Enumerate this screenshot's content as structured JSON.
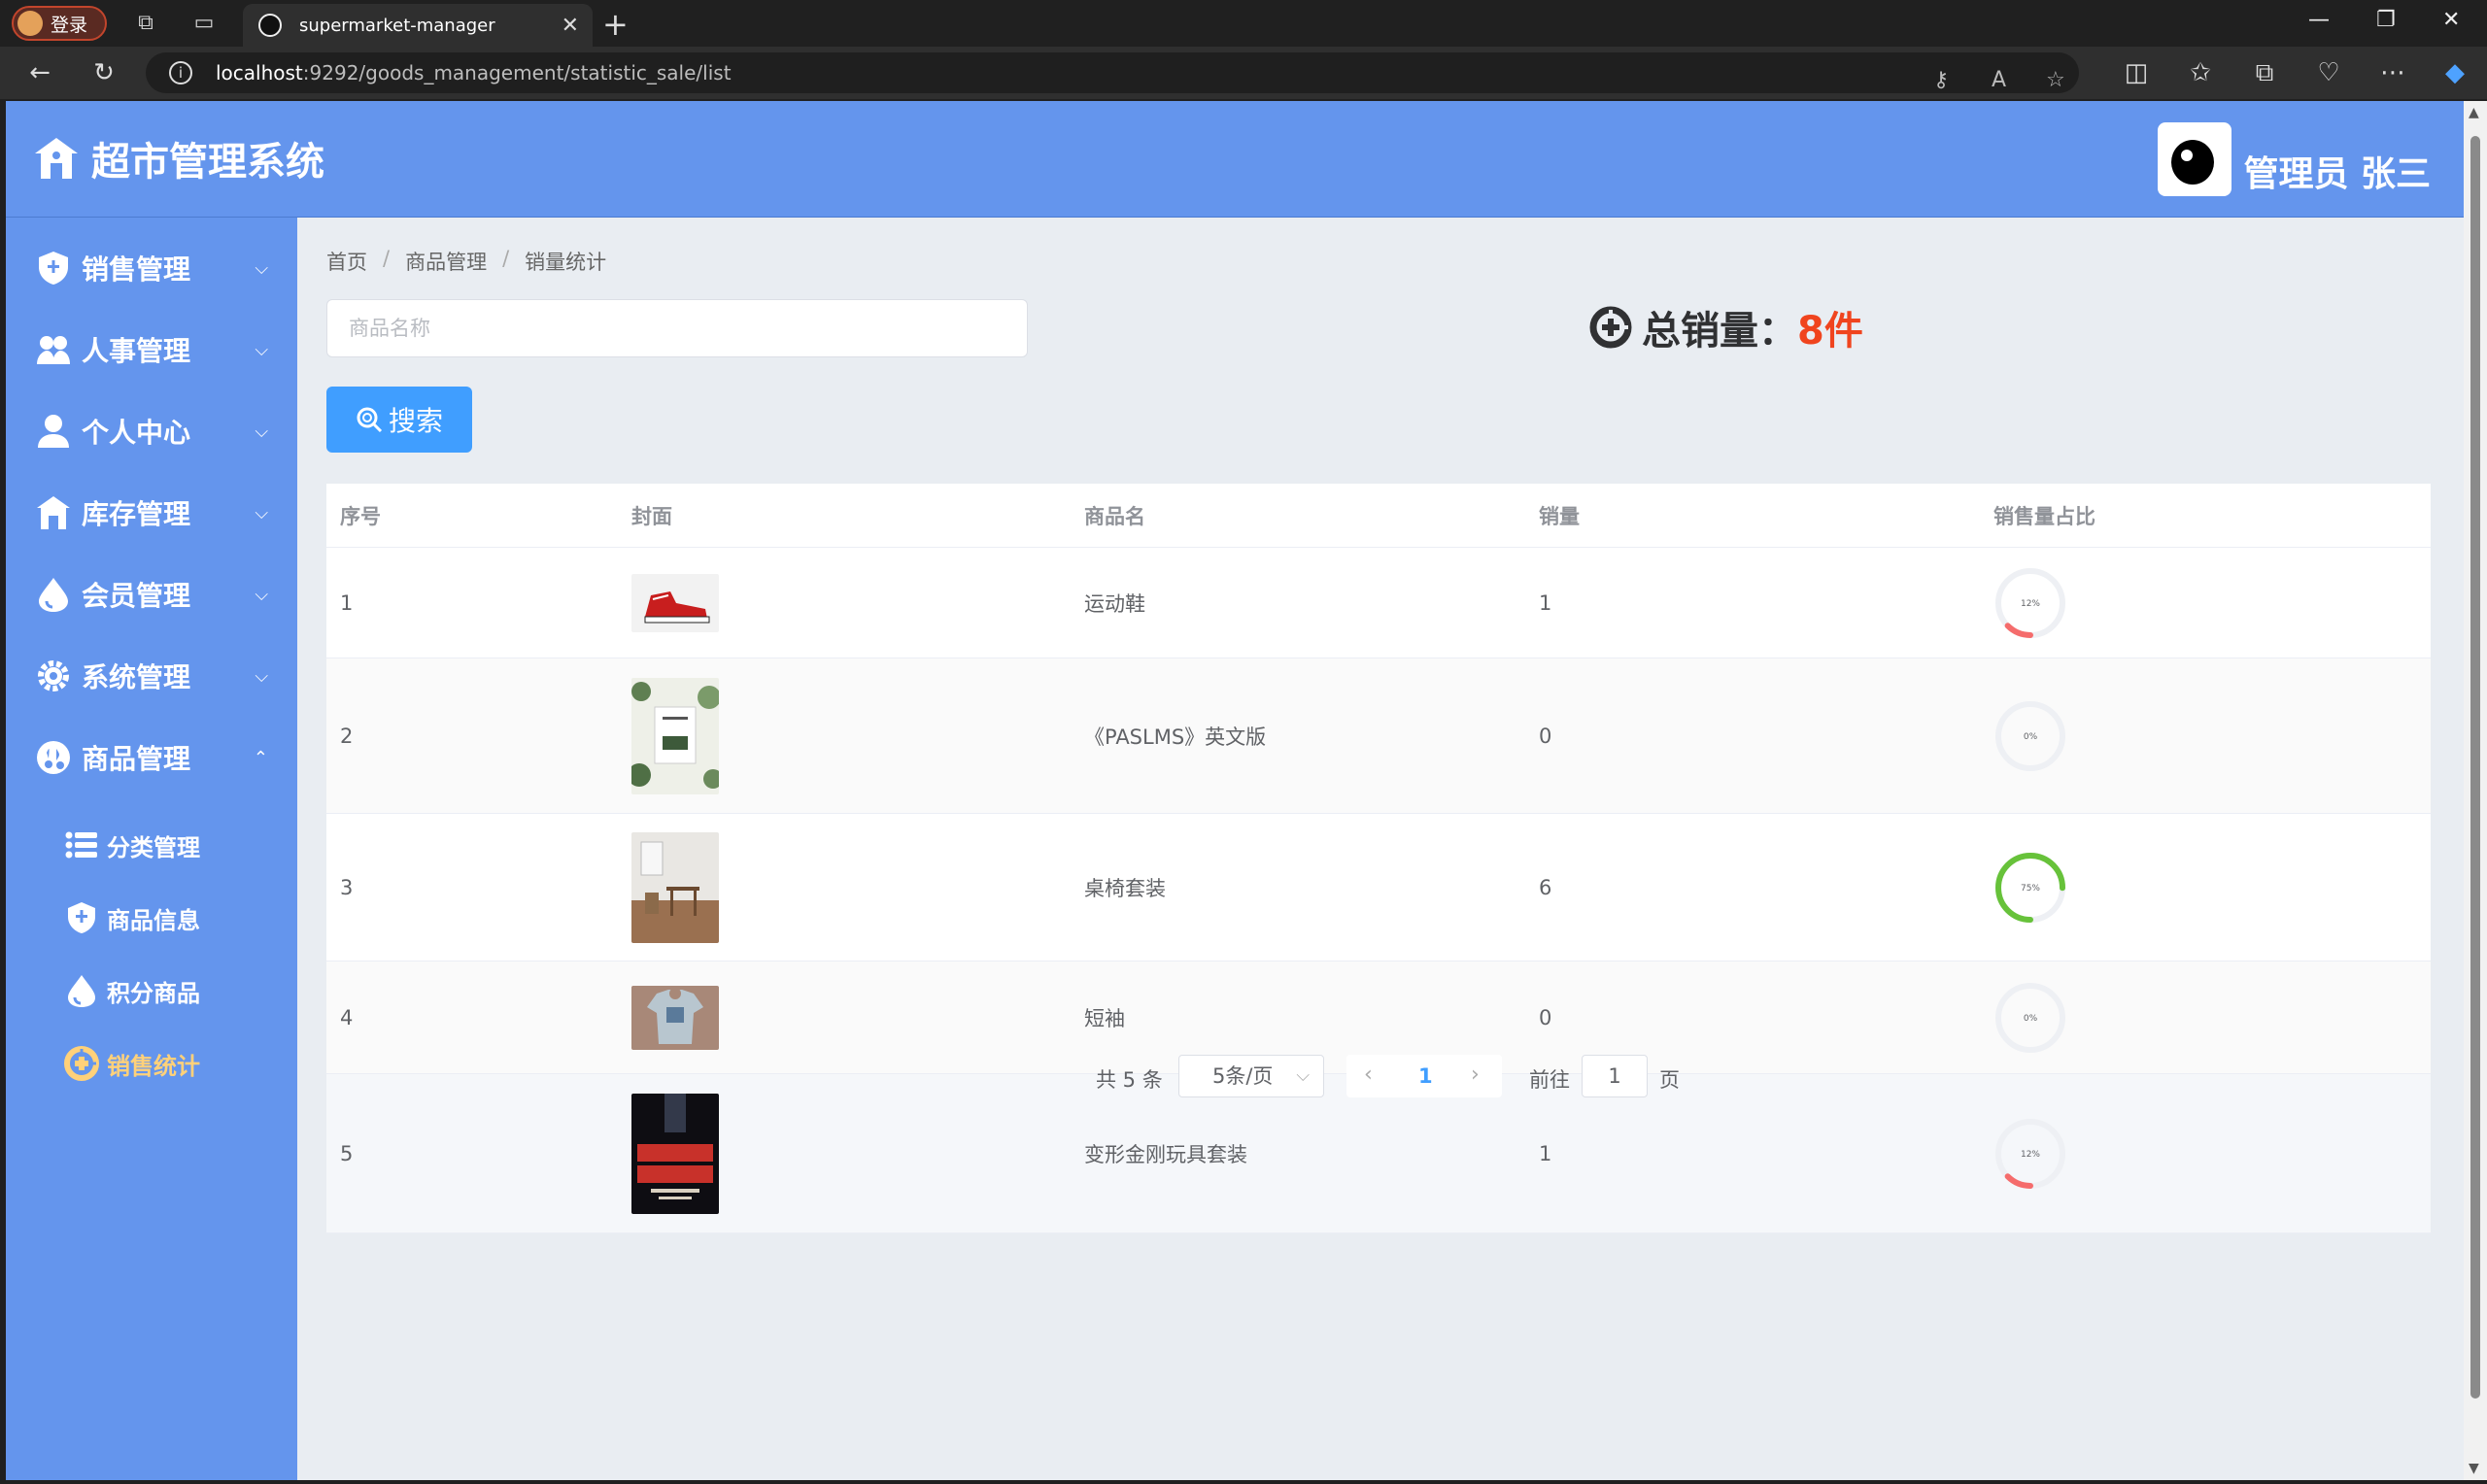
{
  "browser": {
    "profile_label": "登录",
    "tab_title": "supermarket-manager",
    "url_host": "localhost",
    "url_path": ":9292/goods_management/statistic_sale/list"
  },
  "app": {
    "title": "超市管理系统",
    "admin_label": "管理员 张三"
  },
  "sidebar": {
    "menus": [
      {
        "label": "销售管理",
        "icon": "shield-icon"
      },
      {
        "label": "人事管理",
        "icon": "people-icon"
      },
      {
        "label": "个人中心",
        "icon": "person-icon"
      },
      {
        "label": "库存管理",
        "icon": "warehouse-icon"
      },
      {
        "label": "会员管理",
        "icon": "drop-icon"
      },
      {
        "label": "系统管理",
        "icon": "gear-icon"
      },
      {
        "label": "商品管理",
        "icon": "goods-icon",
        "expanded": true
      }
    ],
    "sub_items": [
      {
        "label": "分类管理",
        "icon": "list-icon"
      },
      {
        "label": "商品信息",
        "icon": "shield-icon"
      },
      {
        "label": "积分商品",
        "icon": "drop-icon"
      },
      {
        "label": "销售统计",
        "icon": "stats-icon",
        "active": true
      }
    ]
  },
  "breadcrumb": [
    "首页",
    "商品管理",
    "销量统计"
  ],
  "search": {
    "placeholder": "商品名称",
    "button_label": "搜索"
  },
  "total": {
    "label": "总销量：",
    "value": "8件"
  },
  "table": {
    "headers": [
      "序号",
      "封面",
      "商品名",
      "销量",
      "销售量占比"
    ],
    "rows": [
      {
        "index": "1",
        "name": "运动鞋",
        "sales": "1",
        "percent_label": "12%",
        "percent": 0.125,
        "ring_color": "#f56c6c",
        "cover": "sneaker"
      },
      {
        "index": "2",
        "name": "《PASLMS》英文版",
        "sales": "0",
        "percent_label": "0%",
        "percent": 0,
        "ring_color": "#f56c6c",
        "cover": "book"
      },
      {
        "index": "3",
        "name": "桌椅套装",
        "sales": "6",
        "percent_label": "75%",
        "percent": 0.75,
        "ring_color": "#67c23a",
        "cover": "furniture"
      },
      {
        "index": "4",
        "name": "短袖",
        "sales": "0",
        "percent_label": "0%",
        "percent": 0,
        "ring_color": "#f56c6c",
        "cover": "tshirt"
      },
      {
        "index": "5",
        "name": "变形金刚玩具套装",
        "sales": "1",
        "percent_label": "12%",
        "percent": 0.125,
        "ring_color": "#f56c6c",
        "cover": "poster"
      }
    ]
  },
  "pagination": {
    "total_label": "共 5 条",
    "page_size": "5条/页",
    "current_page": "1",
    "goto_label": "前往",
    "goto_value": "1",
    "page_suffix": "页"
  },
  "colors": {
    "primary": "#6495ed",
    "button": "#409eff",
    "total_value": "#f0441e",
    "active_sub": "#ffd17a"
  }
}
